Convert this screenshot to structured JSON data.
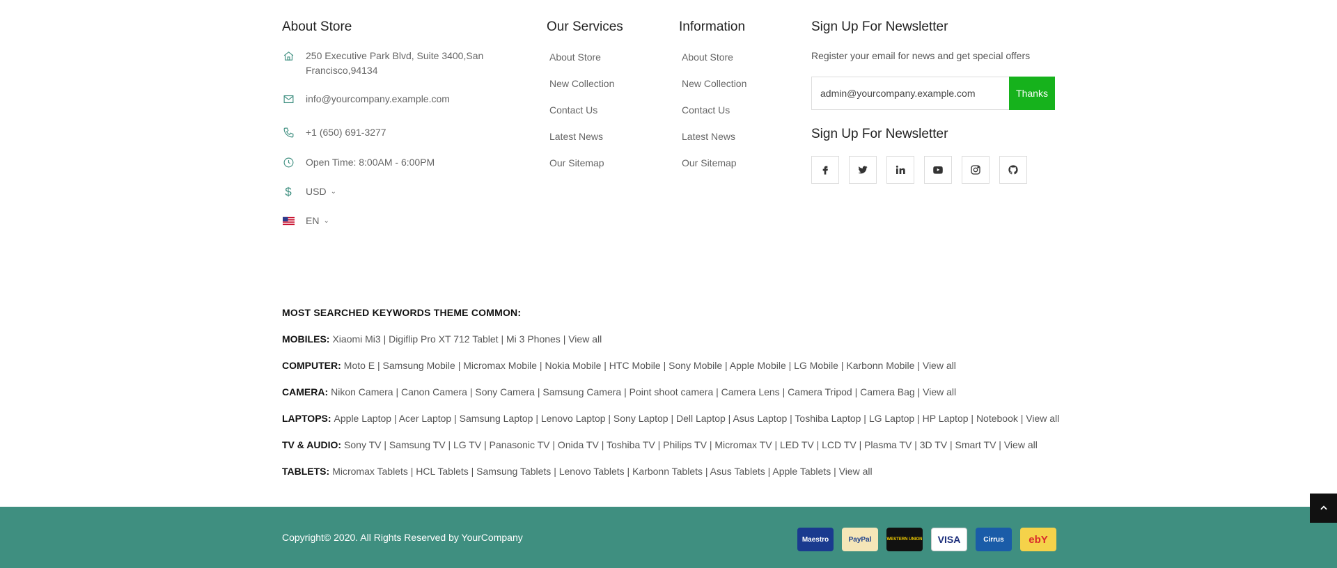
{
  "about": {
    "title": "About Store",
    "address_line1": "250 Executive Park Blvd, Suite 3400,San",
    "address_line2": "Francisco,94134",
    "email": "info@yourcompany.example.com",
    "phone": "+1 (650) 691-3277",
    "hours": "Open Time: 8:00AM - 6:00PM",
    "currency": "USD",
    "language": "EN"
  },
  "services": {
    "title": "Our Services",
    "items": [
      "About Store",
      "New Collection",
      "Contact Us",
      "Latest News",
      "Our Sitemap"
    ]
  },
  "information": {
    "title": "Information",
    "items": [
      "About Store",
      "New Collection",
      "Contact Us",
      "Latest News",
      "Our Sitemap"
    ]
  },
  "newsletter": {
    "title": "Sign Up For Newsletter",
    "text": "Register your email for news and get special offers",
    "input_value": "admin@yourcompany.example.com",
    "button_label": "Thanks",
    "social_title": "Sign Up For Newsletter",
    "socials": [
      "facebook-icon",
      "twitter-icon",
      "linkedin-icon",
      "youtube-icon",
      "instagram-icon",
      "github-icon"
    ]
  },
  "keywords": {
    "title": "MOST SEARCHED KEYWORDS THEME COMMON:",
    "rows": [
      {
        "label": "MOBILES:",
        "text": "Xiaomi Mi3 | Digiflip Pro XT 712 Tablet | Mi 3 Phones | View all"
      },
      {
        "label": "COMPUTER:",
        "text": "Moto E | Samsung Mobile | Micromax Mobile | Nokia Mobile | HTC Mobile | Sony Mobile | Apple Mobile | LG Mobile | Karbonn Mobile | View all"
      },
      {
        "label": "CAMERA:",
        "text": "Nikon Camera | Canon Camera | Sony Camera | Samsung Camera | Point shoot camera | Camera Lens | Camera Tripod | Camera Bag | View all"
      },
      {
        "label": "LAPTOPS:",
        "text": "Apple Laptop | Acer Laptop | Samsung Laptop | Lenovo Laptop | Sony Laptop | Dell Laptop | Asus Laptop | Toshiba Laptop | LG Laptop | HP Laptop | Notebook | View all"
      },
      {
        "label": "TV & AUDIO:",
        "text": "Sony TV | Samsung TV | LG TV | Panasonic TV | Onida TV | Toshiba TV | Philips TV | Micromax TV | LED TV | LCD TV | Plasma TV | 3D TV | Smart TV | View all"
      },
      {
        "label": "TABLETS:",
        "text": "Micromax Tablets | HCL Tablets | Samsung Tablets | Lenovo Tablets | Karbonn Tablets | Asus Tablets | Apple Tablets | View all"
      }
    ]
  },
  "footer": {
    "copyright": "Copyright© 2020. All Rights Reserved by YourCompany",
    "payments": [
      {
        "label": "Maestro",
        "bg": "#1a3a8f",
        "fg": "#ffffff"
      },
      {
        "label": "PayPal",
        "bg": "#f5e6b8",
        "fg": "#1b3f8c"
      },
      {
        "label": "WESTERN UNION",
        "bg": "#111111",
        "fg": "#f5d000"
      },
      {
        "label": "VISA",
        "bg": "#ffffff",
        "fg": "#1a2c7a"
      },
      {
        "label": "Cirrus",
        "bg": "#1a5ca8",
        "fg": "#ffffff"
      },
      {
        "label": "ebY",
        "bg": "#f5d24a",
        "fg": "#d92b2b"
      }
    ]
  },
  "colors": {
    "accent": "#3f8f80",
    "button": "#16b21c"
  }
}
